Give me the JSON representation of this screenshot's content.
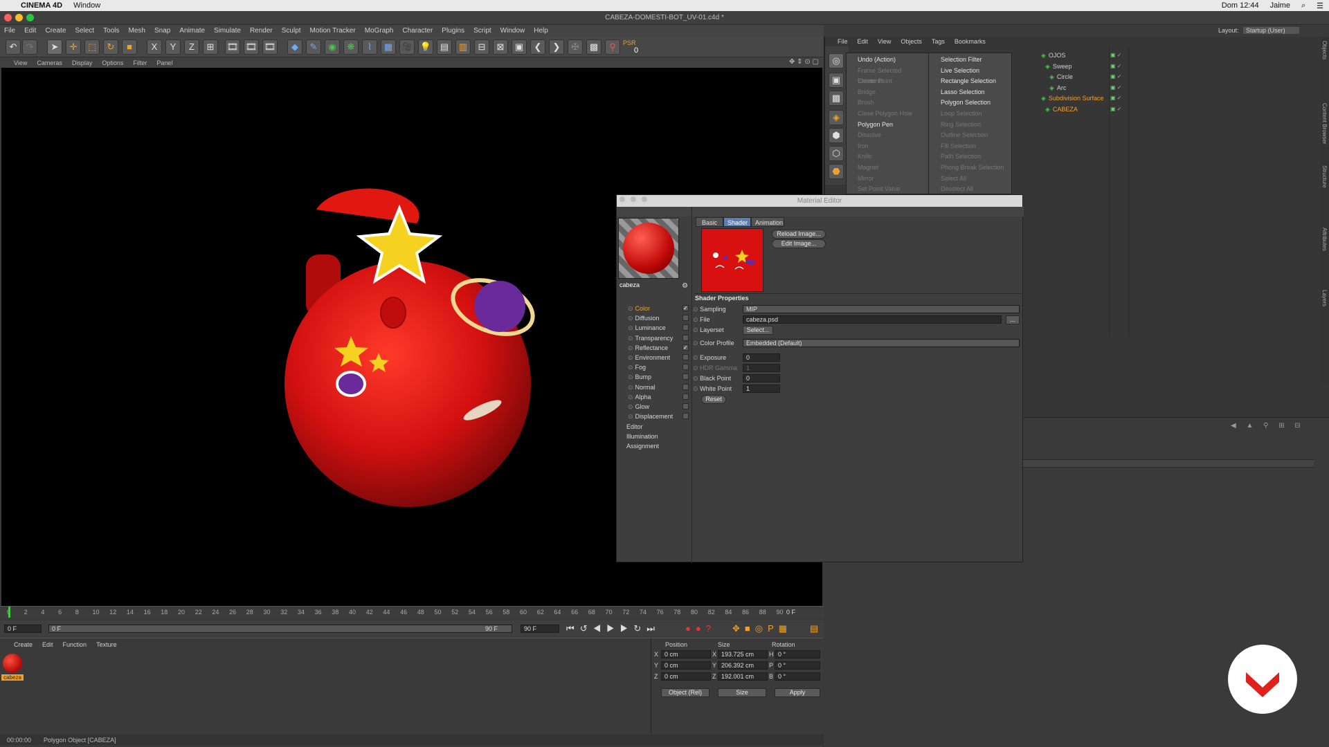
{
  "mac_menu": {
    "app": "CINEMA 4D",
    "window": "Window",
    "clock": "Dom 12:44",
    "user": "Jaime"
  },
  "window_title": "CABEZA-DOMESTI-BOT_UV-01.c4d *",
  "menu": [
    "File",
    "Edit",
    "Create",
    "Select",
    "Tools",
    "Mesh",
    "Snap",
    "Animate",
    "Simulate",
    "Render",
    "Sculpt",
    "Motion Tracker",
    "MoGraph",
    "Character",
    "Plugins",
    "Script",
    "Window",
    "Help"
  ],
  "layout": {
    "label": "Layout:",
    "value": "Startup (User)"
  },
  "toolbar": {
    "x": "X",
    "y": "Y",
    "z": "Z",
    "psr": "PSR",
    "psr_value": "0"
  },
  "viewport_menu": [
    "View",
    "Cameras",
    "Display",
    "Options",
    "Filter",
    "Panel"
  ],
  "object_manager": {
    "menu": [
      "File",
      "Edit",
      "View",
      "Objects",
      "Tags",
      "Bookmarks"
    ],
    "objects": [
      {
        "name": "OJOS"
      },
      {
        "name": "Sweep"
      },
      {
        "name": "Circle"
      },
      {
        "name": "Arc"
      },
      {
        "name": "Subdivision Surface"
      },
      {
        "name": "CABEZA"
      }
    ]
  },
  "popup_menu": {
    "left": [
      {
        "label": "Undo (Action)",
        "enabled": true
      },
      {
        "label": "Frame Selected Elements",
        "enabled": false
      },
      {
        "label": "Create Point",
        "enabled": false
      },
      {
        "label": "Bridge",
        "enabled": false
      },
      {
        "label": "Brush",
        "enabled": false
      },
      {
        "label": "Close Polygon Hole",
        "enabled": false
      },
      {
        "label": "Polygon Pen",
        "enabled": true
      },
      {
        "label": "Dissolve",
        "enabled": false
      },
      {
        "label": "Iron",
        "enabled": false
      },
      {
        "label": "Knife",
        "enabled": false
      },
      {
        "label": "Magnet",
        "enabled": false
      },
      {
        "label": "Mirror",
        "enabled": false
      },
      {
        "label": "Set Point Value",
        "enabled": false
      }
    ],
    "right": [
      {
        "label": "Selection Filter",
        "enabled": true
      },
      {
        "label": "Live Selection",
        "enabled": true
      },
      {
        "label": "Rectangle Selection",
        "enabled": true
      },
      {
        "label": "Lasso Selection",
        "enabled": true
      },
      {
        "label": "Polygon Selection",
        "enabled": true
      },
      {
        "label": "Loop Selection",
        "enabled": false
      },
      {
        "label": "Ring Selection",
        "enabled": false
      },
      {
        "label": "Outline Selection",
        "enabled": false
      },
      {
        "label": "Fill Selection",
        "enabled": false
      },
      {
        "label": "Path Selection",
        "enabled": false
      },
      {
        "label": "Phong Break Selection",
        "enabled": false
      },
      {
        "label": "Select All",
        "enabled": false
      },
      {
        "label": "Deselect All",
        "enabled": false
      }
    ]
  },
  "material_editor": {
    "title": "Material Editor",
    "material_name": "cabeza",
    "tabs": [
      "Basic",
      "Shader",
      "Animation"
    ],
    "active_tab": "Shader",
    "channels": [
      {
        "label": "Color",
        "checked": true,
        "active": true
      },
      {
        "label": "Diffusion",
        "checked": false
      },
      {
        "label": "Luminance",
        "checked": false
      },
      {
        "label": "Transparency",
        "checked": false
      },
      {
        "label": "Reflectance",
        "checked": true
      },
      {
        "label": "Environment",
        "checked": false
      },
      {
        "label": "Fog",
        "checked": false
      },
      {
        "label": "Bump",
        "checked": false
      },
      {
        "label": "Normal",
        "checked": false
      },
      {
        "label": "Alpha",
        "checked": false
      },
      {
        "label": "Glow",
        "checked": false
      },
      {
        "label": "Displacement",
        "checked": false
      }
    ],
    "extra_items": [
      "Editor",
      "Illumination",
      "Assignment"
    ],
    "reload_image": "Reload Image...",
    "edit_image": "Edit Image...",
    "shader_properties": "Shader Properties",
    "props": {
      "sampling_label": "Sampling",
      "sampling_value": "MIP",
      "file_label": "File",
      "file_value": "cabeza.psd",
      "file_btn": "...",
      "layerset_label": "Layerset",
      "layerset_btn": "Select...",
      "colorprofile_label": "Color Profile",
      "colorprofile_value": "Embedded (Default)",
      "exposure_label": "Exposure",
      "exposure_value": "0",
      "hdrgamma_label": "HDR Gamma",
      "hdrgamma_value": "1",
      "blackpoint_label": "Black Point",
      "blackpoint_value": "0",
      "whitepoint_label": "White Point",
      "whitepoint_value": "1",
      "reset": "Reset"
    }
  },
  "timeline": {
    "ticks": [
      "0",
      "2",
      "4",
      "6",
      "8",
      "10",
      "12",
      "14",
      "16",
      "18",
      "20",
      "22",
      "24",
      "26",
      "28",
      "30",
      "32",
      "34",
      "36",
      "38",
      "40",
      "42",
      "44",
      "46",
      "48",
      "50",
      "52",
      "54",
      "56",
      "58",
      "60",
      "62",
      "64",
      "66",
      "68",
      "70",
      "72",
      "74",
      "76",
      "78",
      "80",
      "82",
      "84",
      "86",
      "88",
      "90"
    ],
    "end_frame_label": "0 F",
    "current": "0 F",
    "start": "0 F",
    "range_end": "90 F",
    "max": "90 F"
  },
  "material_manager": {
    "menu": [
      "Create",
      "Edit",
      "Function",
      "Texture"
    ],
    "material": "cabeza"
  },
  "coordinates": {
    "headers": [
      "Position",
      "Size",
      "Rotation"
    ],
    "rows": [
      {
        "axis": "X",
        "pos": "0 cm",
        "size_axis": "X",
        "size": "193.725 cm",
        "rot_axis": "H",
        "rot": "0 °"
      },
      {
        "axis": "Y",
        "pos": "0 cm",
        "size_axis": "Y",
        "size": "206.392 cm",
        "rot_axis": "P",
        "rot": "0 °"
      },
      {
        "axis": "Z",
        "pos": "0 cm",
        "size_axis": "Z",
        "size": "192.001 cm",
        "rot_axis": "B",
        "rot": "0 °"
      }
    ],
    "mode": "Object (Rel)",
    "size_mode": "Size",
    "apply": "Apply"
  },
  "status": {
    "time": "00:00:00",
    "message": "Polygon Object [CABEZA]"
  },
  "side_tabs": [
    "Objects",
    "Content Browser",
    "Structure",
    "Attributes",
    "Layers"
  ],
  "colors": {
    "accent": "#5b7fb0",
    "highlight": "#f0a030",
    "ball": "#d81010"
  }
}
